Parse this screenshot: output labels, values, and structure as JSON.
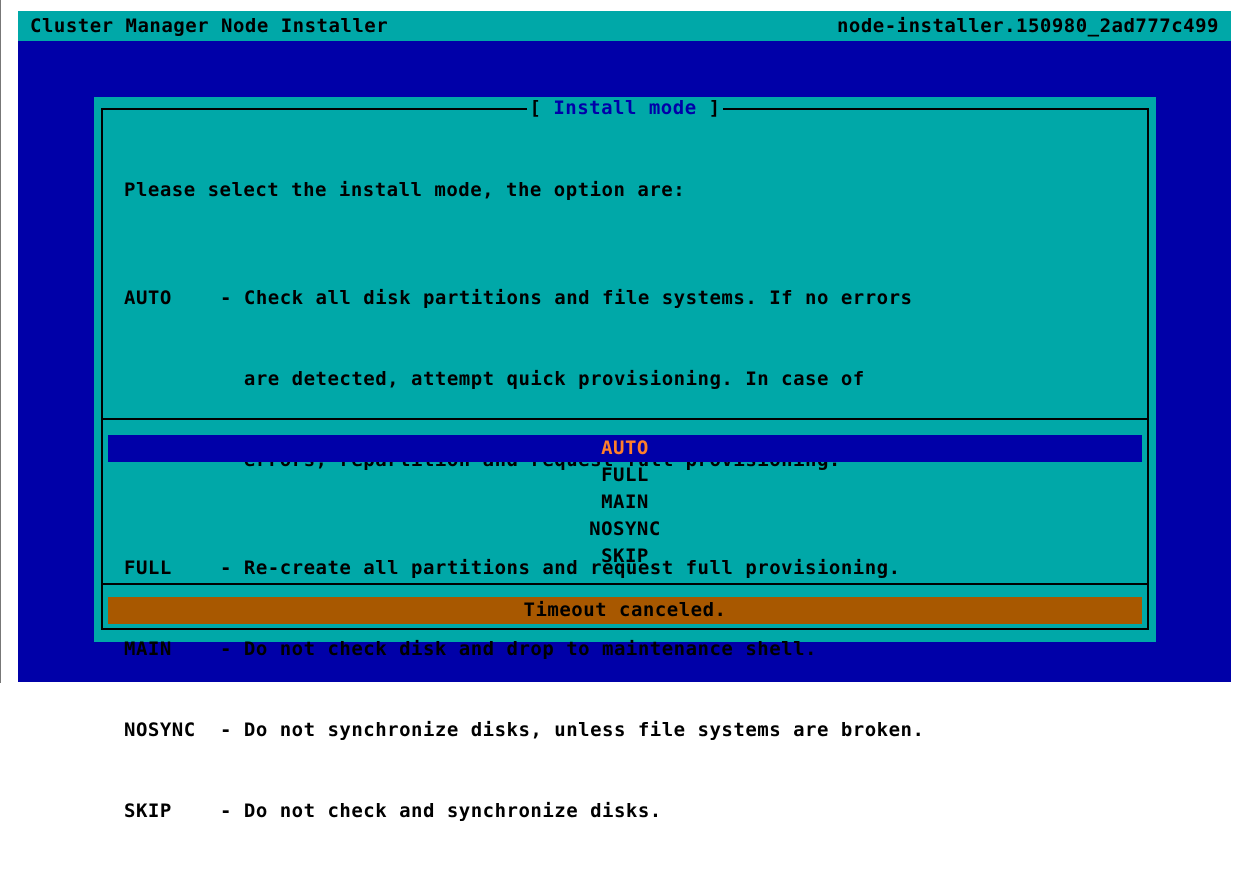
{
  "titlebar": {
    "left": "Cluster Manager Node Installer",
    "right": "node-installer.150980_2ad777c499"
  },
  "dialog": {
    "title_open": "[ ",
    "title": "Install mode",
    "title_close": " ]",
    "intro": "Please select the install mode, the option are:",
    "descriptions": [
      {
        "key": "AUTO",
        "lines": [
          "- Check all disk partitions and file systems. If no errors",
          "  are detected, attempt quick provisioning. In case of",
          "  errors, repartition and request full provisioning."
        ]
      },
      {
        "key": "FULL",
        "lines": [
          "- Re-create all partitions and request full provisioning."
        ]
      },
      {
        "key": "MAIN",
        "lines": [
          "- Do not check disk and drop to maintenance shell."
        ]
      },
      {
        "key": "NOSYNC",
        "lines": [
          "- Do not synchronize disks, unless file systems are broken."
        ]
      },
      {
        "key": "SKIP",
        "lines": [
          "- Do not check and synchronize disks."
        ]
      }
    ],
    "options": [
      "AUTO",
      "FULL",
      "MAIN",
      "NOSYNC",
      "SKIP"
    ],
    "selected_option": "AUTO",
    "status": "Timeout canceled."
  },
  "colors": {
    "screen_bg": "#0000a8",
    "panel_bg": "#00a8a8",
    "selection_fg": "#ff7f2a",
    "status_bg": "#a85800"
  }
}
